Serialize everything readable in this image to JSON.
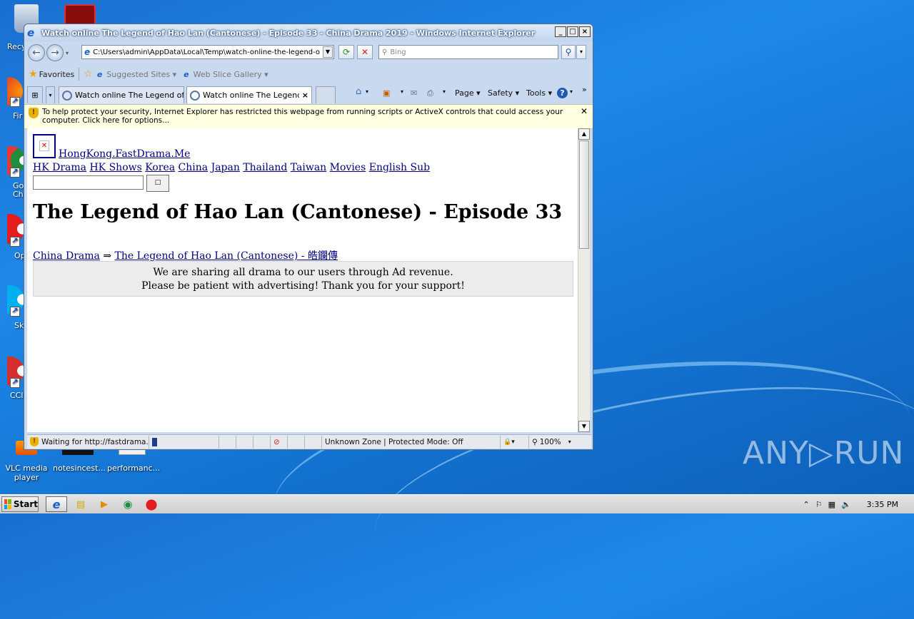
{
  "window": {
    "title": "Watch online The Legend of Hao Lan (Cantonese) - Episode 33 - China Drama 2019 - Windows Internet Explorer",
    "caption_buttons": [
      "_",
      "□",
      "×"
    ]
  },
  "navbar": {
    "back_label": "←",
    "forward_label": "→",
    "address": "C:\\Users\\admin\\AppData\\Local\\Temp\\watch-online-the-legend-of-",
    "search_placeholder": "Bing"
  },
  "favorites_bar": {
    "favorites_label": "Favorites",
    "suggested_sites_label": "Suggested Sites ▾",
    "web_slice_gallery_label": "Web Slice Gallery ▾"
  },
  "tabs": [
    {
      "label": "Watch online The Legend of ..."
    },
    {
      "label": "Watch online The Legend..."
    }
  ],
  "toolbar": {
    "page_label": "Page ▾",
    "safety_label": "Safety ▾",
    "tools_label": "Tools ▾",
    "more_label": "»"
  },
  "infobar": {
    "text": "To help protect your security, Internet Explorer has restricted this webpage from running scripts or ActiveX controls that could access your computer. Click here for options..."
  },
  "page": {
    "site_name": "HongKong.FastDrama.Me",
    "nav_links": [
      "HK Drama",
      "HK Shows",
      "Korea",
      "China",
      "Japan",
      "Thailand",
      "Taiwan",
      "Movies",
      "English Sub"
    ],
    "search_button_label": "□",
    "heading": "The Legend of Hao Lan (Cantonese) - Episode 33",
    "breadcrumb": {
      "category": "China Drama",
      "separator": "⇒",
      "series": "The Legend of Hao Lan (Cantonese) - 皓鑭傳"
    },
    "notice_line1": "We are sharing all drama to our users through Ad revenue.",
    "notice_line2": "Please be patient with advertising! Thank you for your support!"
  },
  "statusbar": {
    "status_text": "Waiting for http://fastdrama.r",
    "zone_text": "Unknown Zone | Protected Mode: Off",
    "zoom_text": "100%"
  },
  "desktop_icons": [
    {
      "label": "VLC media player"
    },
    {
      "label": "notesincest..."
    },
    {
      "label": "performanc..."
    }
  ],
  "desktop_partial_labels": [
    "Recy",
    "Fir",
    "Go Chr",
    "Op",
    "Sk",
    "CCl"
  ],
  "taskbar": {
    "start_label": "Start",
    "clock": "3:35 PM"
  },
  "watermark": "ANY▷RUN"
}
